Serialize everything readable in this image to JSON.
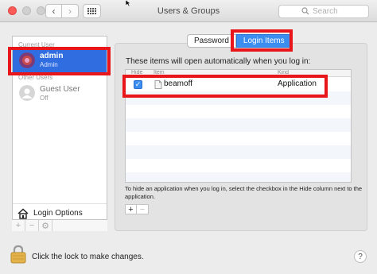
{
  "window": {
    "title": "Users & Groups"
  },
  "search": {
    "placeholder": "Search"
  },
  "sidebar": {
    "current_user_label": "Current User",
    "current_user": {
      "name": "admin",
      "role": "Admin"
    },
    "other_users_label": "Other Users",
    "other_users": [
      {
        "name": "Guest User",
        "role": "Off"
      }
    ],
    "login_options_label": "Login Options"
  },
  "tabs": [
    {
      "label": "Password",
      "active": false
    },
    {
      "label": "Login Items",
      "active": true
    }
  ],
  "login_items": {
    "intro": "These items will open automatically when you log in:",
    "columns": [
      "Hide",
      "Item",
      "Kind"
    ],
    "rows": [
      {
        "hide": true,
        "item": "beamoff",
        "kind": "Application"
      }
    ],
    "help_text": "To hide an application when you log in, select the checkbox in the Hide column next to the application."
  },
  "footer": {
    "lock_text": "Click the lock to make changes.",
    "help_label": "?"
  },
  "colors": {
    "highlight": "#e8151b",
    "selection": "#2f6de0",
    "accent": "#3b8df0"
  }
}
